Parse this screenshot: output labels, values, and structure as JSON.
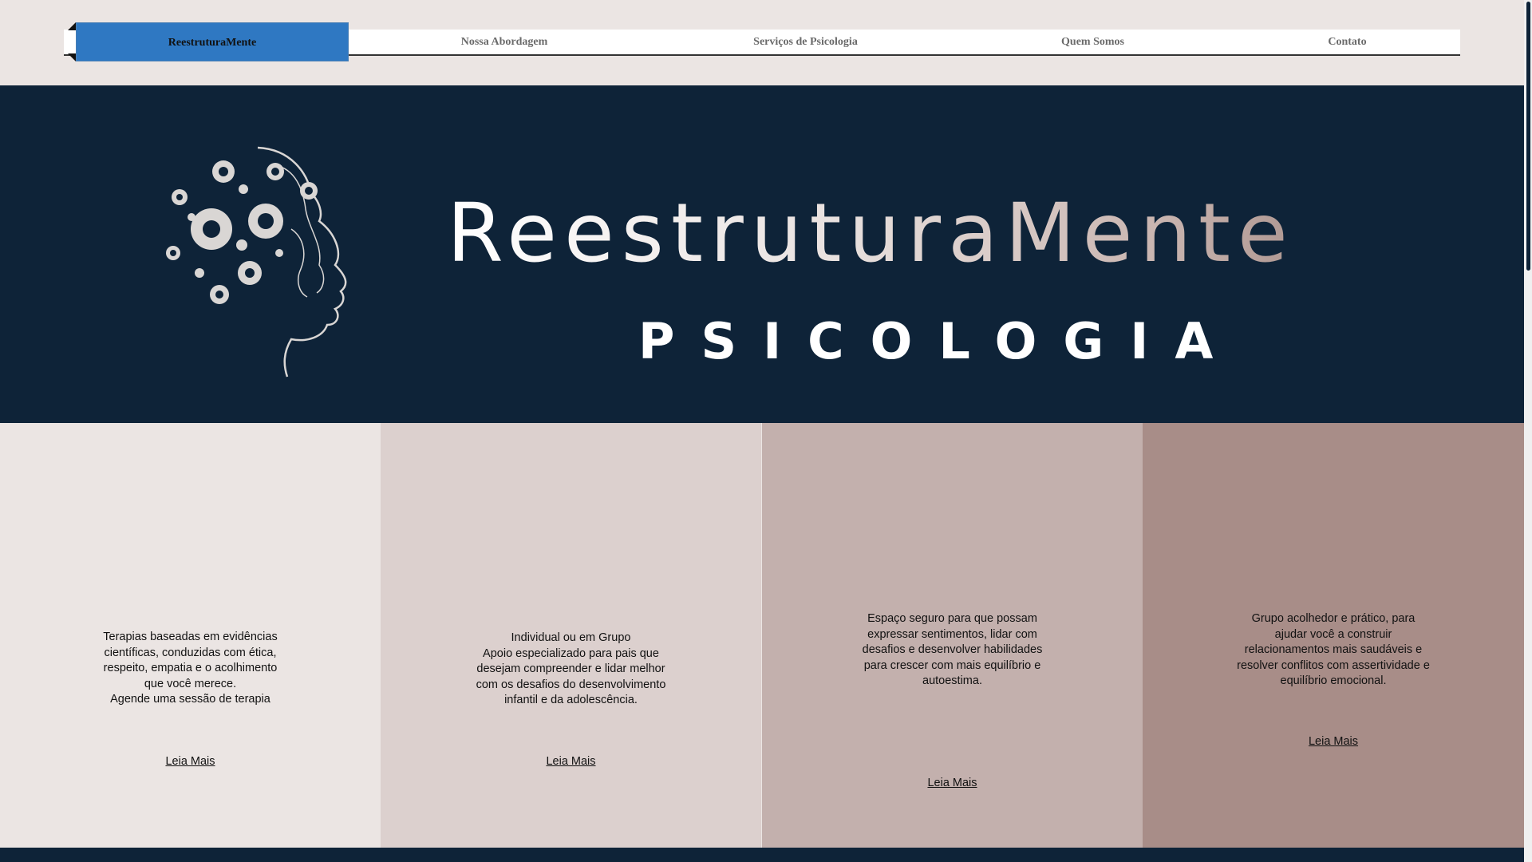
{
  "nav": {
    "items": [
      {
        "label": "ReestruturaMente",
        "active": true
      },
      {
        "label": "Nossa Abordagem",
        "active": false
      },
      {
        "label": "Serviços de Psicologia",
        "active": false
      },
      {
        "label": "Quem Somos",
        "active": false
      },
      {
        "label": "Contato",
        "active": false
      }
    ]
  },
  "hero": {
    "title": "ReestruturaMente",
    "subtitle": "PSICOLOGIA",
    "logo_icon": "head-with-gears-icon"
  },
  "services": [
    {
      "text": "Terapias baseadas em evidências científicas, conduzidas com ética, respeito, empatia e o acolhimento que você merece.\nAgende uma sessão de terapia",
      "link": "Leia Mais"
    },
    {
      "text": "Individual ou em Grupo\nApoio especializado para pais que desejam compreender e lidar melhor com os desafios do desenvolvimento infantil e da adolescência.",
      "link": "Leia Mais"
    },
    {
      "text": "Espaço seguro para que possam expressar sentimentos, lidar com desafios e desenvolver habilidades para crescer com mais equilíbrio e autoestima.",
      "link": "Leia Mais"
    },
    {
      "text": "Grupo acolhedor e prático, para ajudar você a construir relacionamentos mais saudáveis e resolver conflitos com assertividade e equilíbrio emocional.",
      "link": "Leia Mais"
    }
  ],
  "colors": {
    "navy": "#0e2338",
    "accent_blue": "#2f78c2",
    "beige": "#ebe5e3",
    "rose1": "#dcd0ce",
    "rose2": "#c3b0ad",
    "rose3": "#a88d88"
  }
}
